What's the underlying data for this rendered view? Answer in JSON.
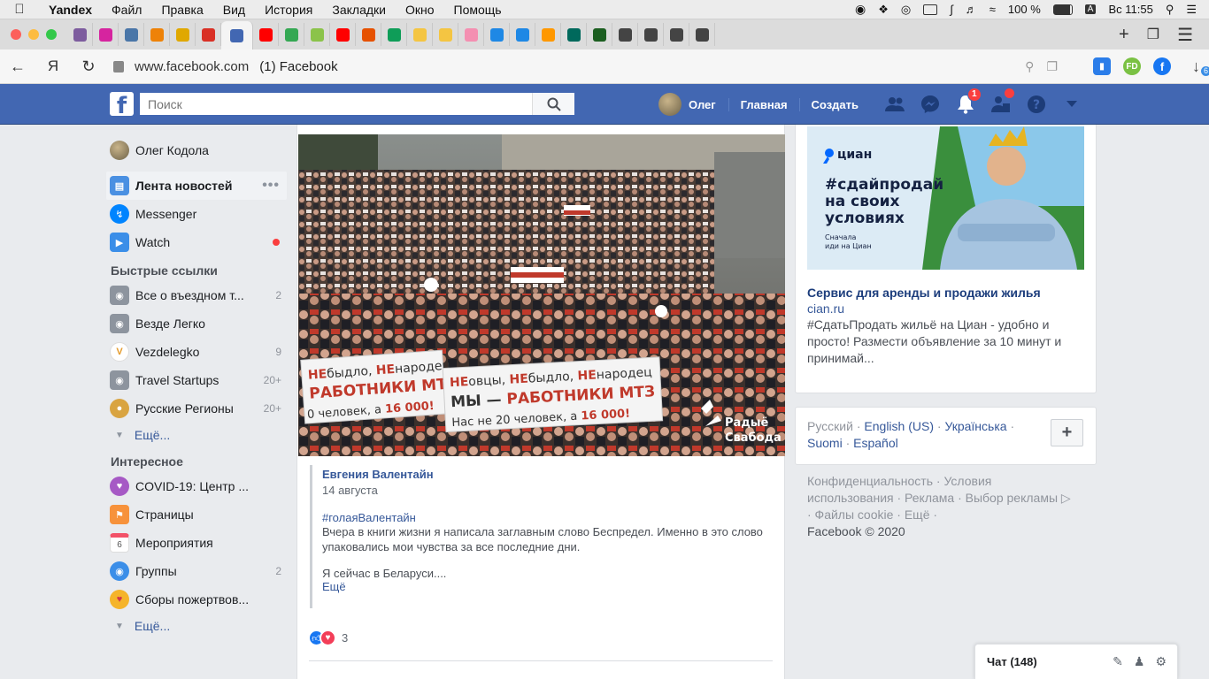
{
  "menubar": {
    "app": "Yandex",
    "items": [
      "Файл",
      "Правка",
      "Вид",
      "История",
      "Закладки",
      "Окно",
      "Помощь"
    ],
    "battery": "100 %",
    "clock": "Вс 11:55"
  },
  "tabs": {
    "favicons": [
      {
        "icon": "user-icon",
        "color": "#7d5c9e"
      },
      {
        "icon": "instagram-icon",
        "color": "#d6249f"
      },
      {
        "icon": "vk-icon",
        "color": "#4a76a8"
      },
      {
        "icon": "ok-icon",
        "color": "#ee8208"
      },
      {
        "icon": "mail-icon",
        "color": "#e0a800"
      },
      {
        "icon": "gmail-icon",
        "color": "#d93025"
      },
      {
        "icon": "facebook-icon",
        "color": "#4267b2",
        "active": true
      },
      {
        "icon": "youtube-icon",
        "color": "#ff0000"
      },
      {
        "icon": "chrome-icon",
        "color": "#34a853"
      },
      {
        "icon": "site-icon",
        "color": "#8bc34a"
      },
      {
        "icon": "youtube-icon",
        "color": "#ff0000"
      },
      {
        "icon": "site-icon",
        "color": "#e65100"
      },
      {
        "icon": "sheet-icon",
        "color": "#0f9d58"
      },
      {
        "icon": "vezdelegko-icon",
        "color": "#f4c542"
      },
      {
        "icon": "vezdelegko-icon",
        "color": "#f4c542"
      },
      {
        "icon": "site-icon",
        "color": "#f48fb1"
      },
      {
        "icon": "amazon-icon",
        "color": "#1e88e5"
      },
      {
        "icon": "amazon-icon",
        "color": "#1e88e5"
      },
      {
        "icon": "site-icon",
        "color": "#ff9800"
      },
      {
        "icon": "chart-icon",
        "color": "#00695c"
      },
      {
        "icon": "site-icon",
        "color": "#1b5e20"
      },
      {
        "icon": "wikipedia-icon",
        "color": "#444444"
      },
      {
        "icon": "wikipedia-icon",
        "color": "#444444"
      },
      {
        "icon": "wikipedia-icon",
        "color": "#444444"
      },
      {
        "icon": "wikipedia-icon",
        "color": "#444444"
      }
    ]
  },
  "address": {
    "url": "www.facebook.com",
    "title": "(1) Facebook",
    "yandex_letter": "Я",
    "download_count": "6"
  },
  "fb_header": {
    "search_placeholder": "Поиск",
    "user_name": "Олег",
    "home": "Главная",
    "create": "Создать",
    "notif_count": "1"
  },
  "left": {
    "profile_name": "Олег Кодола",
    "nav": [
      {
        "label": "Лента новостей"
      },
      {
        "label": "Messenger"
      },
      {
        "label": "Watch"
      }
    ],
    "quick_title": "Быстрые ссылки",
    "quick": [
      {
        "label": "Все о въездном т...",
        "count": "2"
      },
      {
        "label": "Везде Легко",
        "count": ""
      },
      {
        "label": "Vezdelegko",
        "count": "9"
      },
      {
        "label": "Travel Startups",
        "count": "20+"
      },
      {
        "label": "Русские Регионы",
        "count": "20+"
      }
    ],
    "more": "Ещё...",
    "interest_title": "Интересное",
    "interest": [
      {
        "label": "COVID-19: Центр ...",
        "count": ""
      },
      {
        "label": "Страницы",
        "count": ""
      },
      {
        "label": "Мероприятия",
        "count": ""
      },
      {
        "label": "Группы",
        "count": "2"
      },
      {
        "label": "Сборы пожертвов...",
        "count": ""
      }
    ],
    "more2": "Ещё..."
  },
  "post": {
    "banner1": "НЕбыдло, НЕнародец РАБОТНИКИ МТЗ 0 человек, а 16 000!",
    "banner2": "НЕовцы, НЕбыдло, НЕнародец МЫ — РАБОТНИКИ МТЗ Нас не 20 человек, а 16 000!",
    "watermark": "Радыё Свабода",
    "author": "Евгения Валентайн",
    "date": "14 августа",
    "hashtag": "#голаяВалентайн",
    "text": "Вчера в книги жизни я написала заглавным слово Беспредел. Именно в это слово упаковались мои чувства за все последние дни.",
    "text2": "Я сейчас в Беларуси....",
    "more": "Ещё",
    "reactions_count": "3"
  },
  "ad": {
    "brand": "циан",
    "headline": "#сдайпродай на своих условиях",
    "small": "Сначала иди на Циан",
    "title": "Сервис для аренды и продажи жилья",
    "domain": "cian.ru",
    "text": "#СдатьПродать жильё на Циан - удобно и просто! Размести объявление за 10 минут и принимай..."
  },
  "langs": {
    "current": "Русский",
    "en": "English (US)",
    "uk": "Українська",
    "fi": "Suomi",
    "es": "Español"
  },
  "footer": {
    "line1": "Конфиденциальность · Условия",
    "line2": "использования · Реклама · Выбор рекламы ▷",
    "line3": "· Файлы cookie · Ещё ·",
    "copy": "Facebook © 2020"
  },
  "chat": {
    "label": "Чат (148)"
  }
}
